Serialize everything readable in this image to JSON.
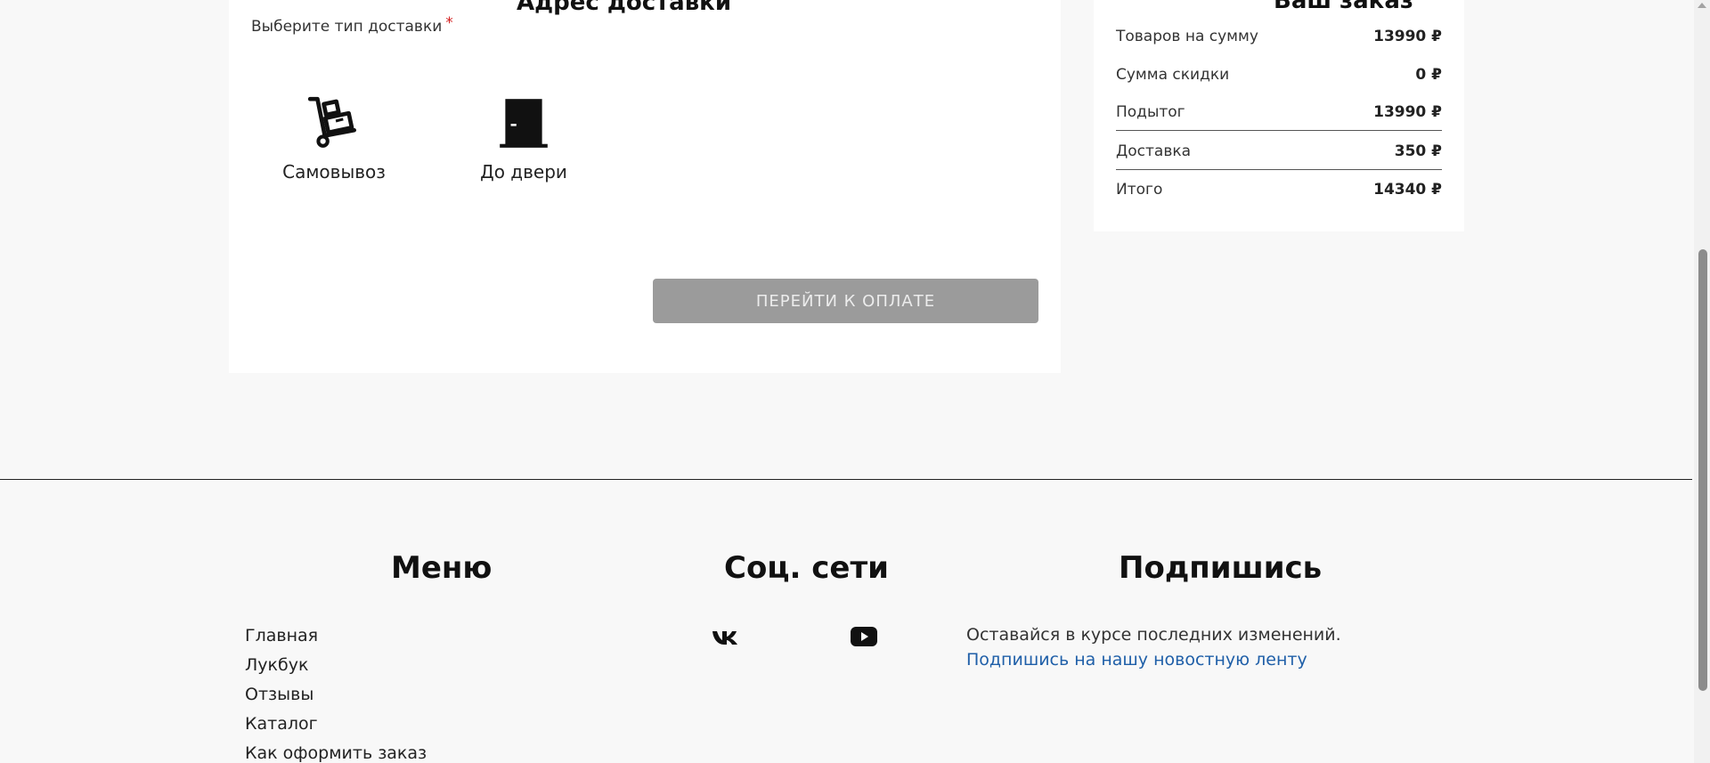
{
  "delivery": {
    "section_title_fragment": "Адрес доставки",
    "label": "Выберите тип доставки",
    "required_mark": "*",
    "options": [
      {
        "label": "Самовывоз",
        "icon": "hand-truck-icon"
      },
      {
        "label": "До двери",
        "icon": "door-icon"
      }
    ],
    "pay_button": "ПЕРЕЙТИ К ОПЛАТЕ"
  },
  "summary": {
    "title_fragment": "Ваш заказ",
    "rows": [
      {
        "label": "Товаров на сумму",
        "value": "13990 ₽"
      },
      {
        "label": "Сумма скидки",
        "value": "0 ₽"
      },
      {
        "label": "Подытог",
        "value": "13990 ₽"
      },
      {
        "label": "Доставка",
        "value": "350 ₽"
      },
      {
        "label": "Итого",
        "value": "14340 ₽"
      }
    ]
  },
  "footer": {
    "menu": {
      "title": "Меню",
      "items": [
        "Главная",
        "Лукбук",
        "Отзывы",
        "Каталог",
        "Как оформить заказ"
      ]
    },
    "social": {
      "title": "Соц. сети",
      "icons": [
        "vk-icon",
        "youtube-icon"
      ]
    },
    "subscribe": {
      "title": "Подпишись",
      "text": "Оставайся в курсе последних изменений.",
      "link": "Подпишись на нашу новостную ленту"
    }
  },
  "colors": {
    "button_disabled": "#9b9b9b",
    "link": "#1f5fa8",
    "required": "#d31f1f",
    "background": "#f8f8f8"
  }
}
